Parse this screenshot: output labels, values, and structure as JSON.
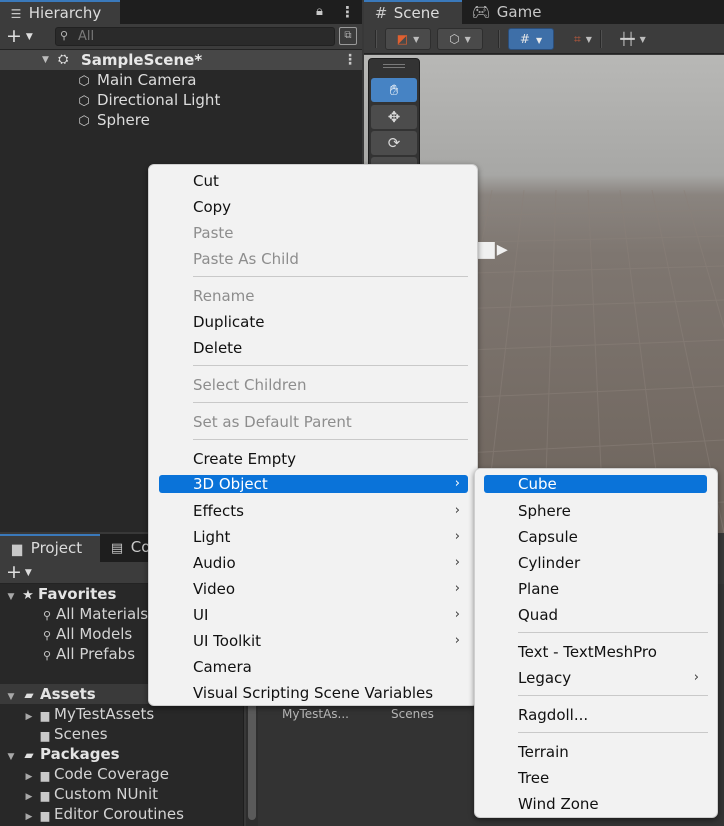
{
  "hierarchy": {
    "tab_label": "Hierarchy",
    "search_placeholder": "All",
    "scene_name": "SampleScene*",
    "items": [
      {
        "label": "Main Camera"
      },
      {
        "label": "Directional Light"
      },
      {
        "label": "Sphere"
      }
    ]
  },
  "scene_view": {
    "tabs": [
      {
        "label": "Scene"
      },
      {
        "label": "Game"
      }
    ],
    "tools": [
      "hand",
      "move",
      "rotate",
      "scale"
    ]
  },
  "project": {
    "tabs": [
      {
        "label": "Project"
      },
      {
        "label": "Co"
      }
    ],
    "favorites_label": "Favorites",
    "favorites": [
      {
        "label": "All Materials"
      },
      {
        "label": "All Models"
      },
      {
        "label": "All Prefabs"
      }
    ],
    "assets_label": "Assets",
    "assets": [
      {
        "label": "MyTestAssets"
      },
      {
        "label": "Scenes"
      }
    ],
    "packages_label": "Packages",
    "packages": [
      {
        "label": "Code Coverage"
      },
      {
        "label": "Custom NUnit"
      },
      {
        "label": "Editor Coroutines"
      }
    ],
    "content_items": [
      {
        "label": "MyTestAs..."
      },
      {
        "label": "Scenes"
      }
    ]
  },
  "context_menu": {
    "items": [
      {
        "label": "Cut",
        "enabled": true
      },
      {
        "label": "Copy",
        "enabled": true
      },
      {
        "label": "Paste",
        "enabled": false
      },
      {
        "label": "Paste As Child",
        "enabled": false
      },
      {
        "label": "Rename",
        "enabled": false
      },
      {
        "label": "Duplicate",
        "enabled": true
      },
      {
        "label": "Delete",
        "enabled": true
      },
      {
        "label": "Select Children",
        "enabled": false
      },
      {
        "label": "Set as Default Parent",
        "enabled": false
      },
      {
        "label": "Create Empty",
        "enabled": true
      },
      {
        "label": "3D Object",
        "enabled": true,
        "submenu": true,
        "highlighted": true
      },
      {
        "label": "Effects",
        "enabled": true,
        "submenu": true
      },
      {
        "label": "Light",
        "enabled": true,
        "submenu": true
      },
      {
        "label": "Audio",
        "enabled": true,
        "submenu": true
      },
      {
        "label": "Video",
        "enabled": true,
        "submenu": true
      },
      {
        "label": "UI",
        "enabled": true,
        "submenu": true
      },
      {
        "label": "UI Toolkit",
        "enabled": true,
        "submenu": true
      },
      {
        "label": "Camera",
        "enabled": true
      },
      {
        "label": "Visual Scripting Scene Variables",
        "enabled": true
      }
    ]
  },
  "submenu_3d_object": {
    "items": [
      {
        "label": "Cube",
        "highlighted": true
      },
      {
        "label": "Sphere"
      },
      {
        "label": "Capsule"
      },
      {
        "label": "Cylinder"
      },
      {
        "label": "Plane"
      },
      {
        "label": "Quad"
      },
      {
        "label": "Text - TextMeshPro"
      },
      {
        "label": "Legacy",
        "submenu": true
      },
      {
        "label": "Ragdoll..."
      },
      {
        "label": "Terrain"
      },
      {
        "label": "Tree"
      },
      {
        "label": "Wind Zone"
      }
    ]
  },
  "colors": {
    "menu_highlight": "#0a73d9",
    "tab_accent": "#3a79bb",
    "panel_bg": "#282828"
  }
}
